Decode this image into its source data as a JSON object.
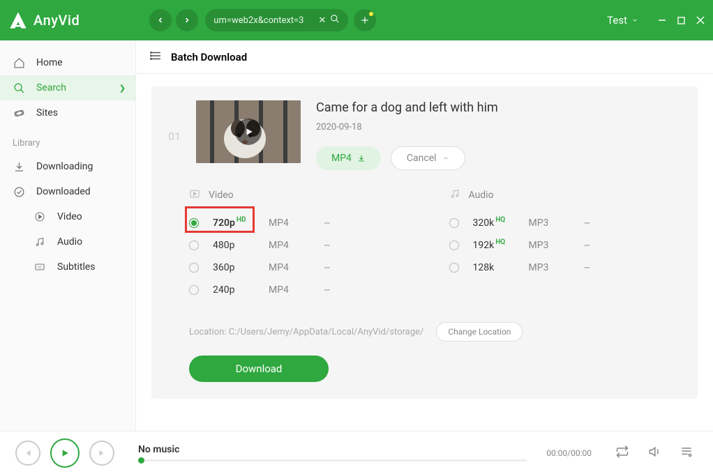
{
  "header": {
    "app_name": "AnyVid",
    "url_text": "um=web2x&context=3",
    "test_label": "Test"
  },
  "sidebar": {
    "items": [
      {
        "label": "Home",
        "icon": "home-icon"
      },
      {
        "label": "Search",
        "icon": "search-icon"
      },
      {
        "label": "Sites",
        "icon": "sites-icon"
      }
    ],
    "library_label": "Library",
    "library_items": [
      {
        "label": "Downloading",
        "icon": "download-icon"
      },
      {
        "label": "Downloaded",
        "icon": "check-icon"
      }
    ],
    "sub_items": [
      {
        "label": "Video",
        "icon": "play-circle-icon"
      },
      {
        "label": "Audio",
        "icon": "music-icon"
      },
      {
        "label": "Subtitles",
        "icon": "cc-icon"
      }
    ]
  },
  "batch": {
    "title": "Batch Download"
  },
  "card": {
    "index": "01",
    "title": "Came for a dog and left with him",
    "date": "2020-09-18",
    "mp4_label": "MP4",
    "cancel_label": "Cancel"
  },
  "options": {
    "video_label": "Video",
    "audio_label": "Audio",
    "video": [
      {
        "quality": "720p",
        "badge": "HD",
        "format": "MP4",
        "size": "--",
        "selected": true
      },
      {
        "quality": "480p",
        "badge": "",
        "format": "MP4",
        "size": "--",
        "selected": false
      },
      {
        "quality": "360p",
        "badge": "",
        "format": "MP4",
        "size": "--",
        "selected": false
      },
      {
        "quality": "240p",
        "badge": "",
        "format": "MP4",
        "size": "--",
        "selected": false
      }
    ],
    "audio": [
      {
        "quality": "320k",
        "badge": "HQ",
        "format": "MP3",
        "size": "--",
        "selected": false
      },
      {
        "quality": "192k",
        "badge": "HQ",
        "format": "MP3",
        "size": "--",
        "selected": false
      },
      {
        "quality": "128k",
        "badge": "",
        "format": "MP3",
        "size": "--",
        "selected": false
      }
    ]
  },
  "location": {
    "label": "Location:",
    "path": "C:/Users/Jemy/AppData/Local/AnyVid/storage/",
    "change_label": "Change Location"
  },
  "download_label": "Download",
  "player": {
    "title": "No music",
    "time": "00:00/00:00"
  }
}
